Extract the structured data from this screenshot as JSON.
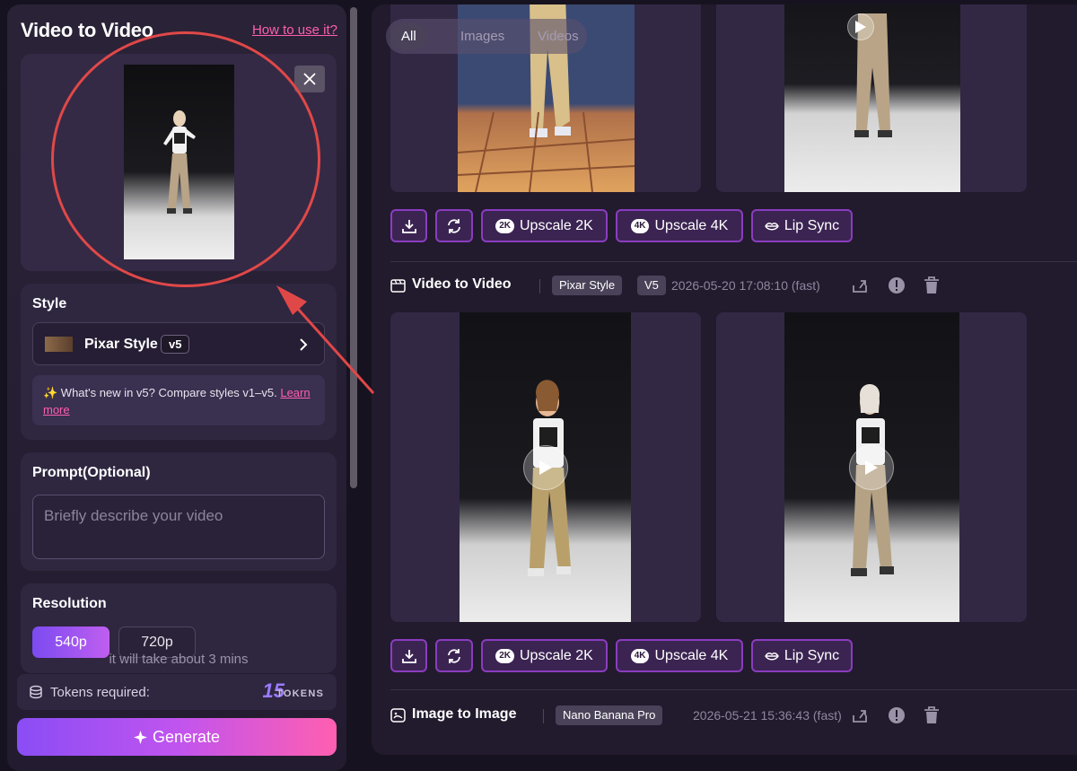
{
  "left_panel": {
    "title": "Video to Video",
    "how_to_link": "How to use it?",
    "style": {
      "label": "Style",
      "name": "Pixar Style",
      "version": "v5",
      "whats_new_prefix": "✨ What's new in v5? Compare styles v1–v5.",
      "learn_more": "Learn more"
    },
    "prompt": {
      "label": "Prompt(Optional)",
      "placeholder": "Briefly describe your video"
    },
    "resolution": {
      "label": "Resolution",
      "options": [
        "540p",
        "720p"
      ],
      "selected": "540p",
      "note": "it will take about 3 mins"
    },
    "tokens": {
      "label": "Tokens required:",
      "count": "15",
      "unit": "TOKENS"
    },
    "generate_label": "Generate"
  },
  "right_panel": {
    "filter_tabs": [
      "All",
      "Images",
      "Videos"
    ],
    "active_tab": "All",
    "actions": {
      "upscale_2k": "Upscale 2K",
      "upscale_4k": "Upscale 4K",
      "lip_sync": "Lip Sync",
      "badge_2k": "2K",
      "badge_4k": "4K"
    },
    "entries": [
      {
        "title": "Video to Video",
        "chips": [
          "Pixar Style",
          "V5"
        ],
        "timestamp": "2026-05-20 17:08:10 (fast)"
      },
      {
        "title": "Image to Image",
        "chips": [
          "Nano Banana Pro"
        ],
        "timestamp": "2026-05-21 15:36:43 (fast)"
      }
    ]
  },
  "colors": {
    "accent_pink": "#ff5fb0",
    "accent_purple": "#8a4df5",
    "annotation_red": "#e04848"
  }
}
